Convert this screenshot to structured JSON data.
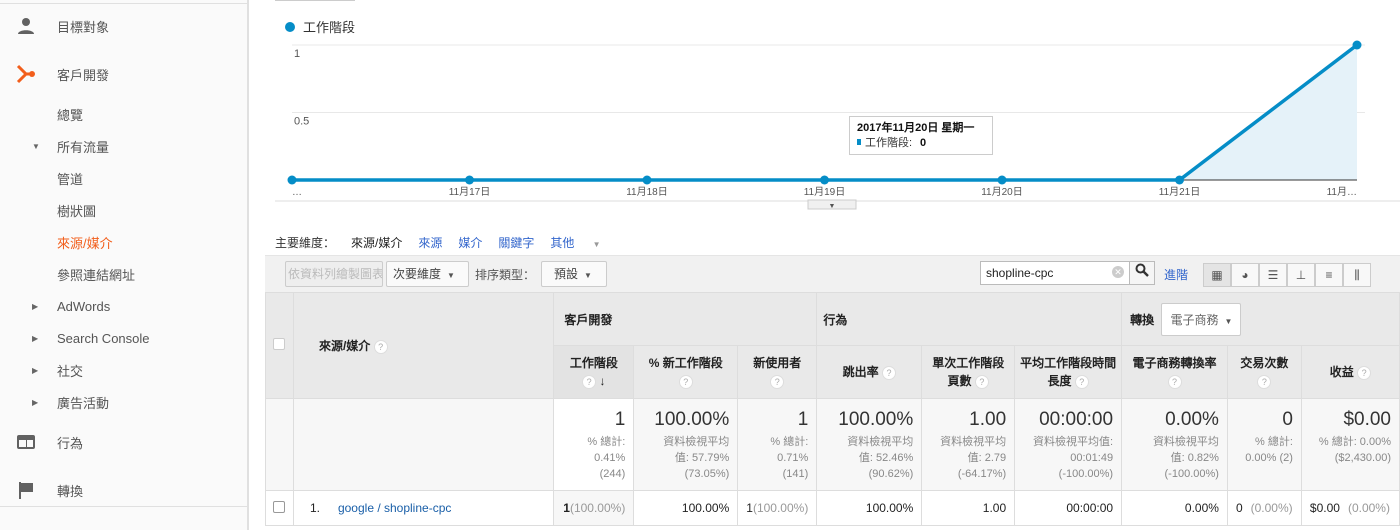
{
  "sidebar": {
    "items": [
      {
        "label": "目標對象",
        "icon": "person-icon"
      },
      {
        "label": "客戶開發",
        "icon": "acquisition-icon"
      },
      {
        "label": "總覽"
      },
      {
        "label": "所有流量",
        "expanded": true
      },
      {
        "label": "管道"
      },
      {
        "label": "樹狀圖"
      },
      {
        "label": "來源/媒介",
        "active": true
      },
      {
        "label": "參照連結網址"
      },
      {
        "label": "AdWords"
      },
      {
        "label": "Search Console"
      },
      {
        "label": "社交"
      },
      {
        "label": "廣告活動"
      },
      {
        "label": "行為",
        "icon": "behavior-icon"
      },
      {
        "label": "轉換",
        "icon": "flag-icon"
      }
    ],
    "active_color": "#f25e1b"
  },
  "chart_data": {
    "type": "area",
    "legend": "工作階段",
    "series": [
      {
        "name": "工作階段",
        "values": [
          0,
          0,
          0,
          0,
          0,
          0,
          1
        ]
      }
    ],
    "x_labels": [
      "…",
      "11月17日",
      "11月18日",
      "11月19日",
      "11月20日",
      "11月21日",
      "11月…"
    ],
    "y_ticks": [
      "1",
      "0.5"
    ],
    "ylim": [
      0,
      1
    ],
    "color": "#058dc7",
    "tooltip": {
      "title": "2017年11月20日 星期一",
      "label": "工作階段:",
      "value": "0"
    }
  },
  "dimensions": {
    "label": "主要維度：",
    "current": "來源/媒介",
    "links": [
      "來源",
      "媒介",
      "關鍵字",
      "其他"
    ]
  },
  "toolbar": {
    "plot_rows": "依資料列繪製圖表",
    "secondary_dim": "次要維度",
    "sort_label": "排序類型：",
    "sort_value": "預設",
    "search_value": "shopline-cpc",
    "advanced": "進階"
  },
  "table": {
    "dim_header": "來源/媒介",
    "groups": {
      "acq": "客戶開發",
      "beh": "行為",
      "conv": "轉換",
      "conv_select": "電子商務"
    },
    "columns": [
      "工作階段",
      "% 新工作階段",
      "新使用者",
      "跳出率",
      "單次工作階段頁數",
      "平均工作階段時間長度",
      "電子商務轉換率",
      "交易次數",
      "收益"
    ],
    "totals": [
      {
        "value": "1",
        "sub": [
          "% 總計:",
          "0.41%",
          "(244)"
        ]
      },
      {
        "value": "100.00%",
        "sub": [
          "資料檢視平均",
          "值: 57.79%",
          "(73.05%)"
        ]
      },
      {
        "value": "1",
        "sub": [
          "% 總計:",
          "0.71%",
          "(141)"
        ]
      },
      {
        "value": "100.00%",
        "sub": [
          "資料檢視平均",
          "值: 52.46%",
          "(90.62%)"
        ]
      },
      {
        "value": "1.00",
        "sub": [
          "資料檢視平均",
          "值: 2.79",
          "(-64.17%)"
        ]
      },
      {
        "value": "00:00:00",
        "sub": [
          "資料檢視平均值:",
          "00:01:49",
          "(-100.00%)"
        ]
      },
      {
        "value": "0.00%",
        "sub": [
          "資料檢視平均",
          "值: 0.82%",
          "(-100.00%)"
        ]
      },
      {
        "value": "0",
        "sub": [
          "% 總計:",
          "0.00% (2)",
          ""
        ]
      },
      {
        "value": "$0.00",
        "sub": [
          "% 總計: 0.00%",
          "($2,430.00)",
          ""
        ]
      }
    ],
    "rows": [
      {
        "index": "1.",
        "dim": "google / shopline-cpc",
        "cells": [
          [
            "1",
            "(100.00%)"
          ],
          [
            "100.00%",
            ""
          ],
          [
            "1",
            "(100.00%)"
          ],
          [
            "100.00%",
            ""
          ],
          [
            "1.00",
            ""
          ],
          [
            "00:00:00",
            ""
          ],
          [
            "0.00%",
            ""
          ],
          [
            "0",
            "(0.00%)"
          ],
          [
            "$0.00",
            "(0.00%)"
          ]
        ]
      }
    ]
  }
}
